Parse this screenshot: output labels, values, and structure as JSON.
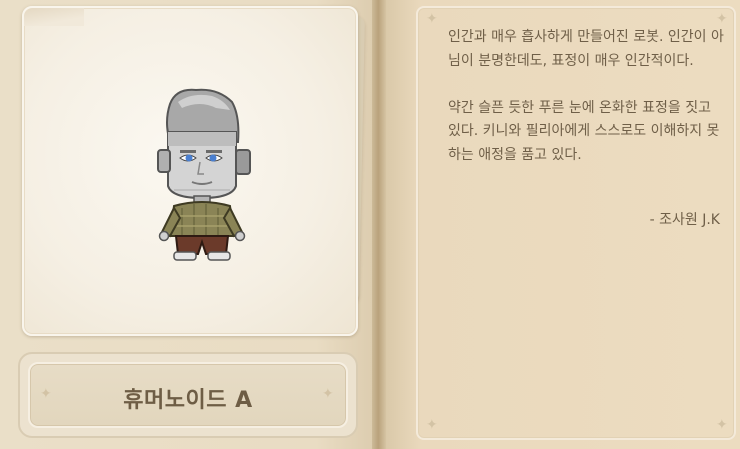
{
  "monster": {
    "name": "휴머노이드 A"
  },
  "description": {
    "paragraph1": "인간과 매우 흡사하게 만들어진 로봇. 인간이 아님이 분명한데도, 표정이 매우 인간적이다.",
    "paragraph2": "약간 슬픈 듯한 푸른 눈에 온화한 표정을 짓고 있다. 키니와 필리아에게 스스로도 이해하지 못하는 애정을 품고 있다.",
    "signature": "- 조사원 J.K"
  },
  "icons": {
    "decoration": "sparkle-star",
    "character": "humanoid-robot-sprite"
  },
  "colors": {
    "page": "#e7dac1",
    "text": "#6f5f48",
    "name_text": "#6e5d45",
    "robot_metal": "#c9c9c9",
    "robot_eyes": "#4a7fd0",
    "shirt": "#8a8456"
  }
}
